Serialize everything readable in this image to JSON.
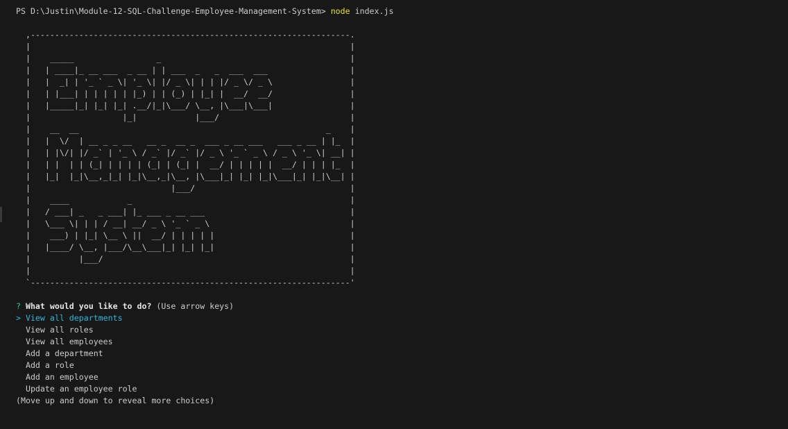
{
  "command_line": {
    "prompt": "PS D:\\Justin\\Module-12-SQL-Challenge-Employee-Management-System> ",
    "command": "node",
    "args": " index.js"
  },
  "banner": {
    "art_lines": [
      "",
      " _____                 _                       ",
      "| ____|_ __ ___  _ __ | | ___  _   _  ___  ___ ",
      "|  _| | '_ ` _ \\| '_ \\| |/ _ \\| | | |/ _ \\/ _ \\",
      "| |___| | | | | | |_) | | (_) | |_| |  __/  __/",
      "|_____|_| |_| |_| .__/|_|\\___/ \\__, |\\___|\\___|",
      "                |_|            |___/           ",
      " __  __                                                   _   ",
      "|  \\/  | __ _ _ __   __ _  __ _  ___ _ __ ___   ___ _ __ | |_ ",
      "| |\\/| |/ _` | '_ \\ / _` |/ _` |/ _ \\ '_ ` _ \\ / _ \\ '_ \\| __|",
      "| |  | | (_| | | | | (_| | (_| |  __/ | | | | |  __/ | | | |_ ",
      "|_|  |_|\\__,_|_| |_|\\__,_|\\__, |\\___|_| |_| |_|\\___|_| |_|\\__|",
      "                          |___/                               ",
      " ____            _                 ",
      "/ ___| _   _ ___| |_ ___ _ __ ___  ",
      "\\___ \\| | | / __| __/ _ \\ '_ ` _ \\ ",
      " ___) | |_| \\__ \\ ||  __/ | | | | |",
      "|____/ \\__, |___/\\__\\___|_| |_| |_|",
      "       |___/                       ",
      ""
    ]
  },
  "question": {
    "marker": "? ",
    "text": "What would you like to do?",
    "hint": " (Use arrow keys)"
  },
  "menu": {
    "pointer": "> ",
    "selected_index": 0,
    "items": [
      "View all departments",
      "View all roles",
      "View all employees",
      "Add a department",
      "Add a role",
      "Add an employee",
      "Update an employee role"
    ],
    "more_hint": "(Move up and down to reveal more choices)"
  },
  "colors": {
    "background": "#181818",
    "text": "#cccccc",
    "command": "#e5e510",
    "question_marker": "#23d18b",
    "selected": "#29b8db"
  }
}
